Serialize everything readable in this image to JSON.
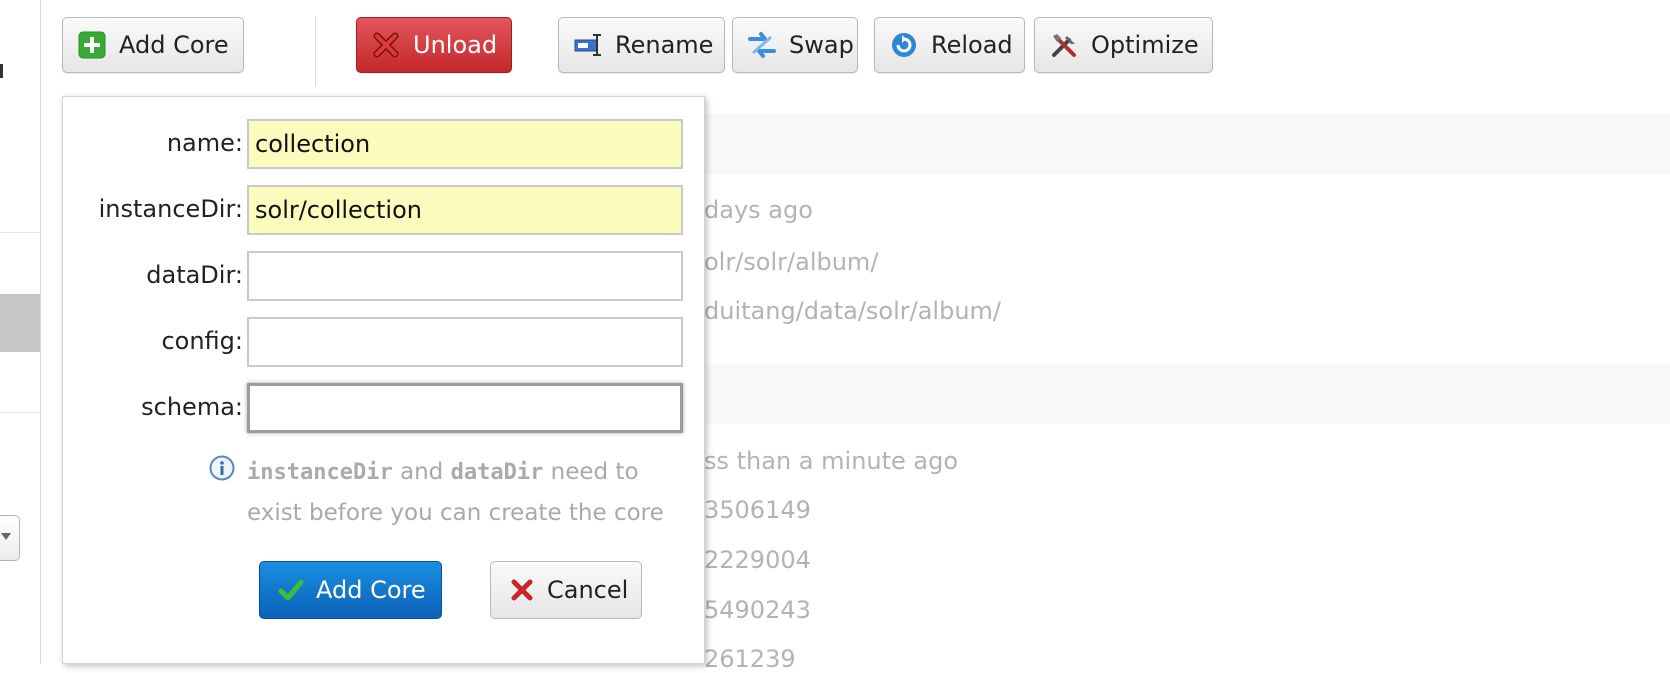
{
  "toolbar": {
    "add_core": "Add Core",
    "unload": "Unload",
    "rename": "Rename",
    "swap": "Swap",
    "reload": "Reload",
    "optimize": "Optimize"
  },
  "background_rows": [
    "days ago",
    "olr/solr/album/",
    "duitang/data/solr/album/",
    "ss than a minute ago",
    "3506149",
    "2229004",
    "5490243",
    "261239"
  ],
  "form": {
    "name_label": "name:",
    "name_value": "collection",
    "instance_dir_label": "instanceDir:",
    "instance_dir_value": "solr/collection",
    "data_dir_label": "dataDir:",
    "data_dir_value": "",
    "config_label": "config:",
    "config_value": "",
    "schema_label": "schema:",
    "schema_value": "",
    "hint_code1": "instanceDir",
    "hint_and": "and",
    "hint_code2": "dataDir",
    "hint_rest": "need to exist before you can create the core",
    "submit_label": "Add Core",
    "cancel_label": "Cancel"
  },
  "colors": {
    "unload_red": "#c9302c",
    "submit_blue": "#1177d2",
    "required_yellow": "#fbfbbd"
  },
  "icons": [
    "plus-icon",
    "cross-icon",
    "rename-icon",
    "swap-icon",
    "reload-icon",
    "tools-icon",
    "info-icon",
    "checkmark-icon"
  ]
}
